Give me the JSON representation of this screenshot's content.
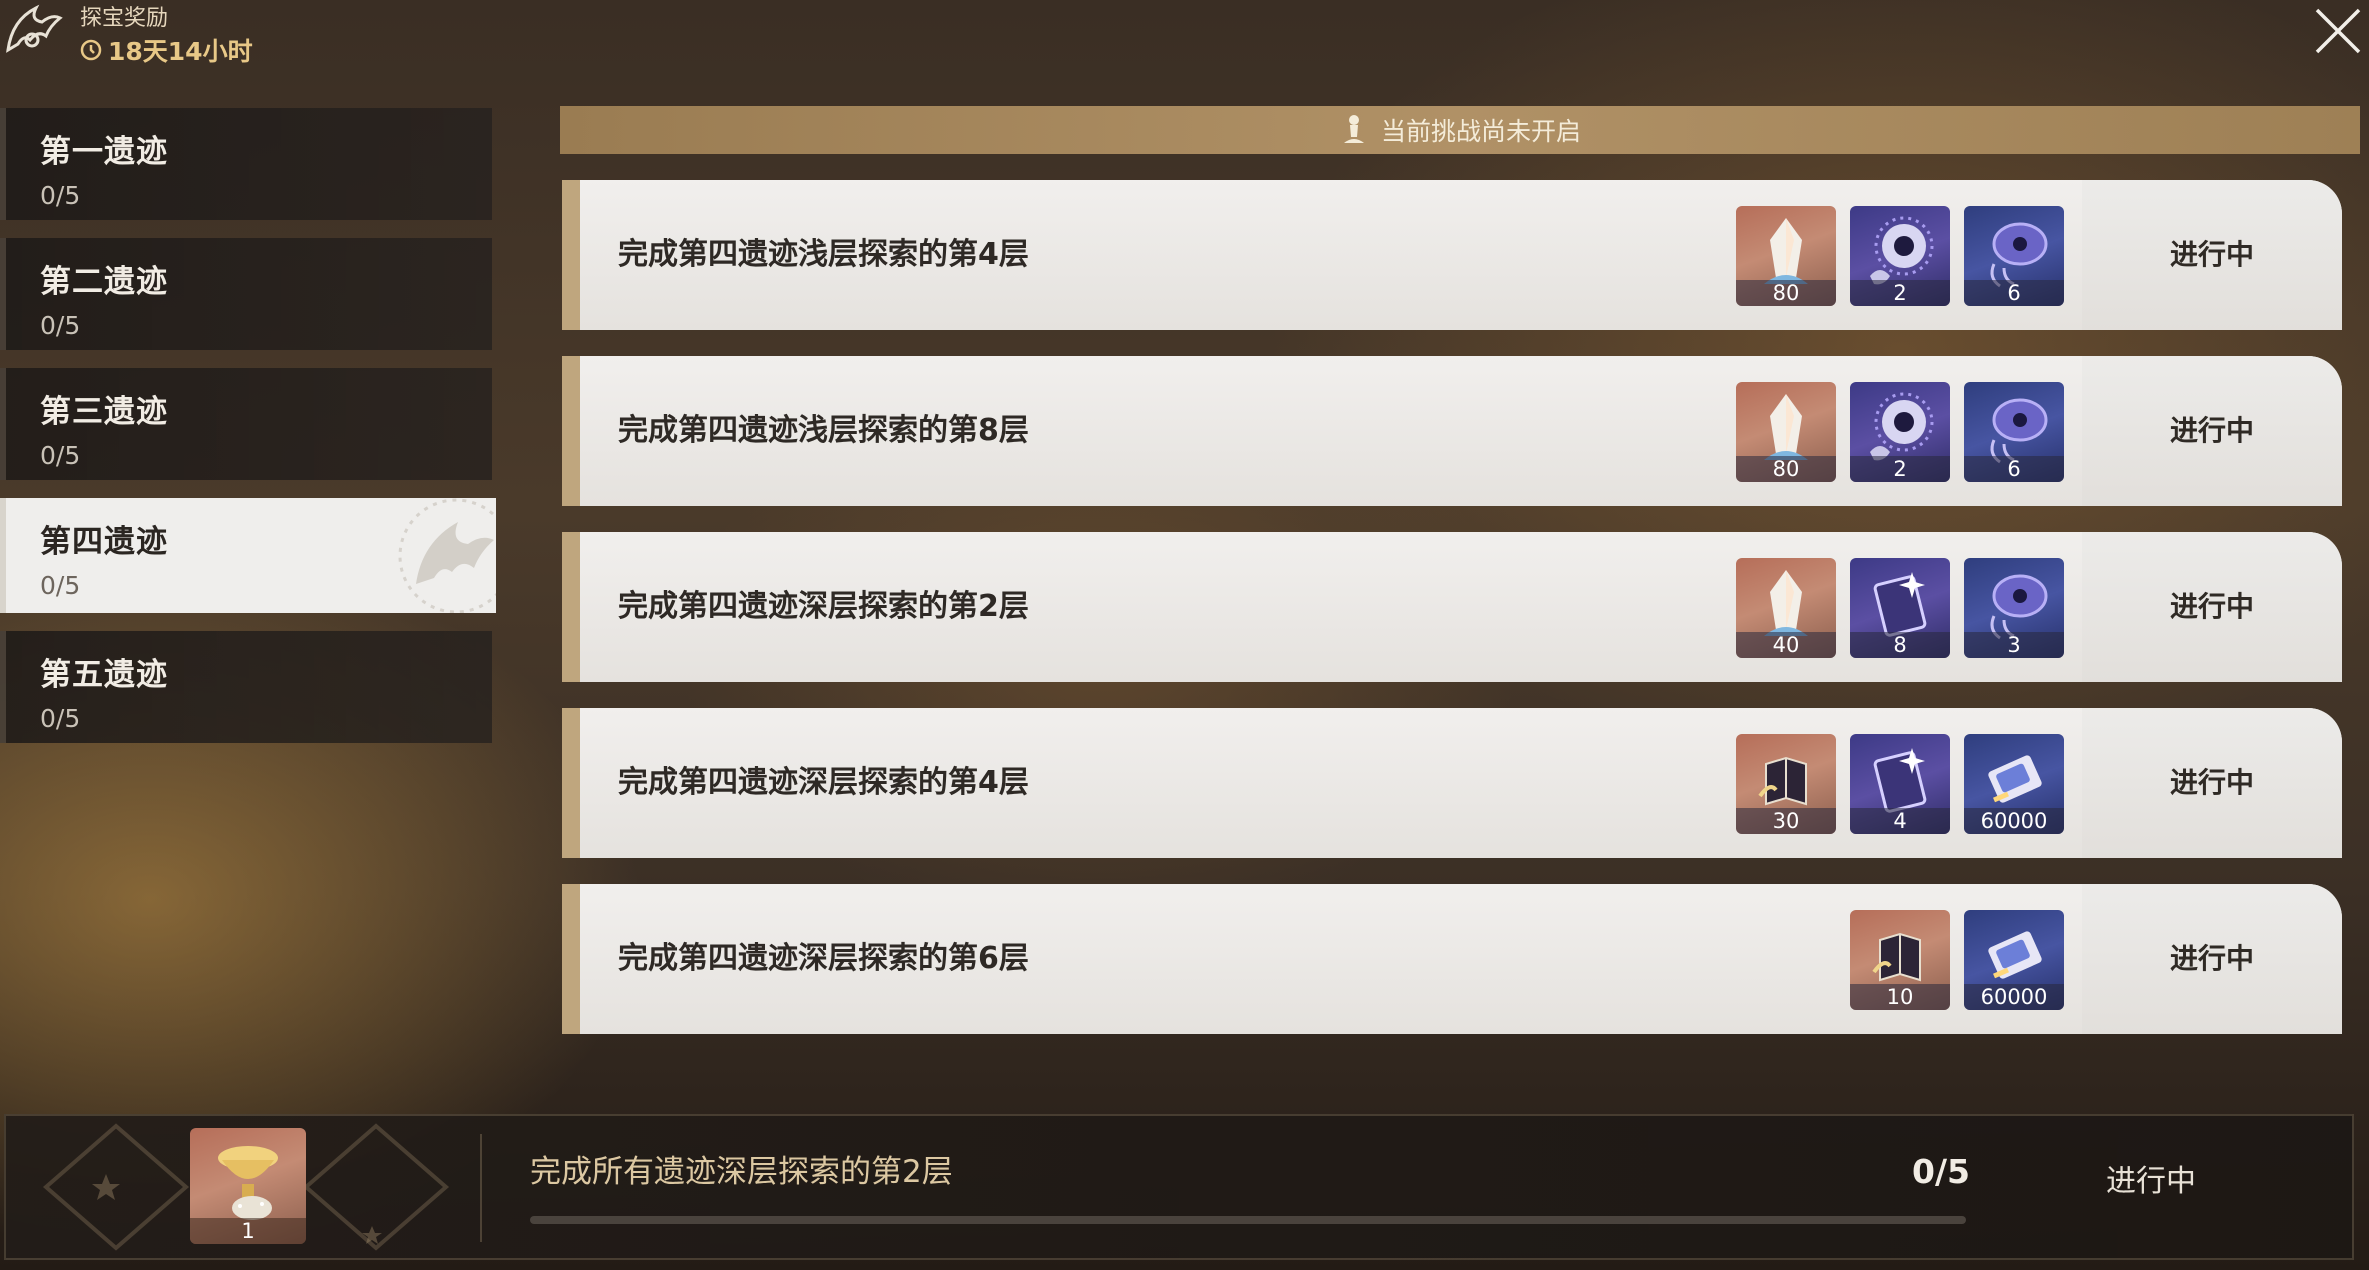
{
  "header": {
    "title": "探宝奖励",
    "timer": "18天14小时",
    "logo_icon": "winged-emblem-icon",
    "close_icon": "close-icon"
  },
  "sidebar": {
    "items": [
      {
        "label": "第一遗迹",
        "progress": "0/5",
        "active": false
      },
      {
        "label": "第二遗迹",
        "progress": "0/5",
        "active": false
      },
      {
        "label": "第三遗迹",
        "progress": "0/5",
        "active": false
      },
      {
        "label": "第四遗迹",
        "progress": "0/5",
        "active": true
      },
      {
        "label": "第五遗迹",
        "progress": "0/5",
        "active": false
      }
    ]
  },
  "banner": {
    "text": "当前挑战尚未开启",
    "icon": "pawn-icon"
  },
  "tasks": [
    {
      "desc": "完成第四遗迹浅层探索的第4层",
      "status": "进行中",
      "rewards": [
        {
          "icon": "crystal-icon",
          "count": "80",
          "bg": "orange"
        },
        {
          "icon": "eye-orb-icon",
          "count": "2",
          "bg": "purple"
        },
        {
          "icon": "eye-disk-icon",
          "count": "6",
          "bg": "blue"
        }
      ]
    },
    {
      "desc": "完成第四遗迹浅层探索的第8层",
      "status": "进行中",
      "rewards": [
        {
          "icon": "crystal-icon",
          "count": "80",
          "bg": "orange"
        },
        {
          "icon": "eye-orb-icon",
          "count": "2",
          "bg": "purple"
        },
        {
          "icon": "eye-disk-icon",
          "count": "6",
          "bg": "blue"
        }
      ]
    },
    {
      "desc": "完成第四遗迹深层探索的第2层",
      "status": "进行中",
      "rewards": [
        {
          "icon": "crystal-icon",
          "count": "40",
          "bg": "orange"
        },
        {
          "icon": "glowing-card-icon",
          "count": "8",
          "bg": "purple"
        },
        {
          "icon": "eye-disk-icon",
          "count": "3",
          "bg": "blue"
        }
      ]
    },
    {
      "desc": "完成第四遗迹深层探索的第4层",
      "status": "进行中",
      "rewards": [
        {
          "icon": "book-icon",
          "count": "30",
          "bg": "orange"
        },
        {
          "icon": "glowing-card-icon",
          "count": "4",
          "bg": "purple"
        },
        {
          "icon": "credit-chip-icon",
          "count": "60000",
          "bg": "blue"
        }
      ]
    },
    {
      "desc": "完成第四遗迹深层探索的第6层",
      "status": "进行中",
      "rewards": [
        {
          "icon": "book-icon",
          "count": "10",
          "bg": "orange"
        },
        {
          "icon": "credit-chip-icon",
          "count": "60000",
          "bg": "blue"
        }
      ]
    }
  ],
  "bottom": {
    "desc": "完成所有遗迹深层探索的第2层",
    "progress": "0/5",
    "progress_fraction": 0,
    "status": "进行中",
    "reward": {
      "icon": "golden-trophy-icon",
      "count": "1"
    }
  }
}
